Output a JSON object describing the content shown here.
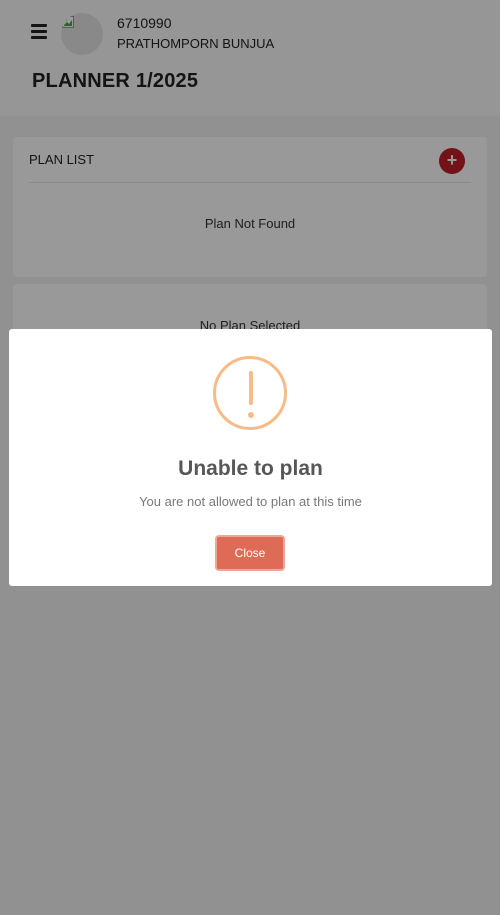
{
  "header": {
    "user_id": "6710990",
    "user_name": "PRATHOMPORN BUNJUA",
    "page_title": "PLANNER 1/2025",
    "menu_icon": "hamburger-menu-icon",
    "avatar_icon": "broken-image-icon"
  },
  "plan_list": {
    "title": "PLAN LIST",
    "add_label": "+",
    "empty_text": "Plan Not Found"
  },
  "plan_detail": {
    "empty_text": "No Plan Selected"
  },
  "modal": {
    "icon": "warning-icon",
    "title": "Unable to plan",
    "message": "You are not allowed to plan at this time",
    "close_label": "Close"
  },
  "colors": {
    "accent_red": "#c0202a",
    "warning": "#f8bb86",
    "close_button": "#dd6b55"
  }
}
